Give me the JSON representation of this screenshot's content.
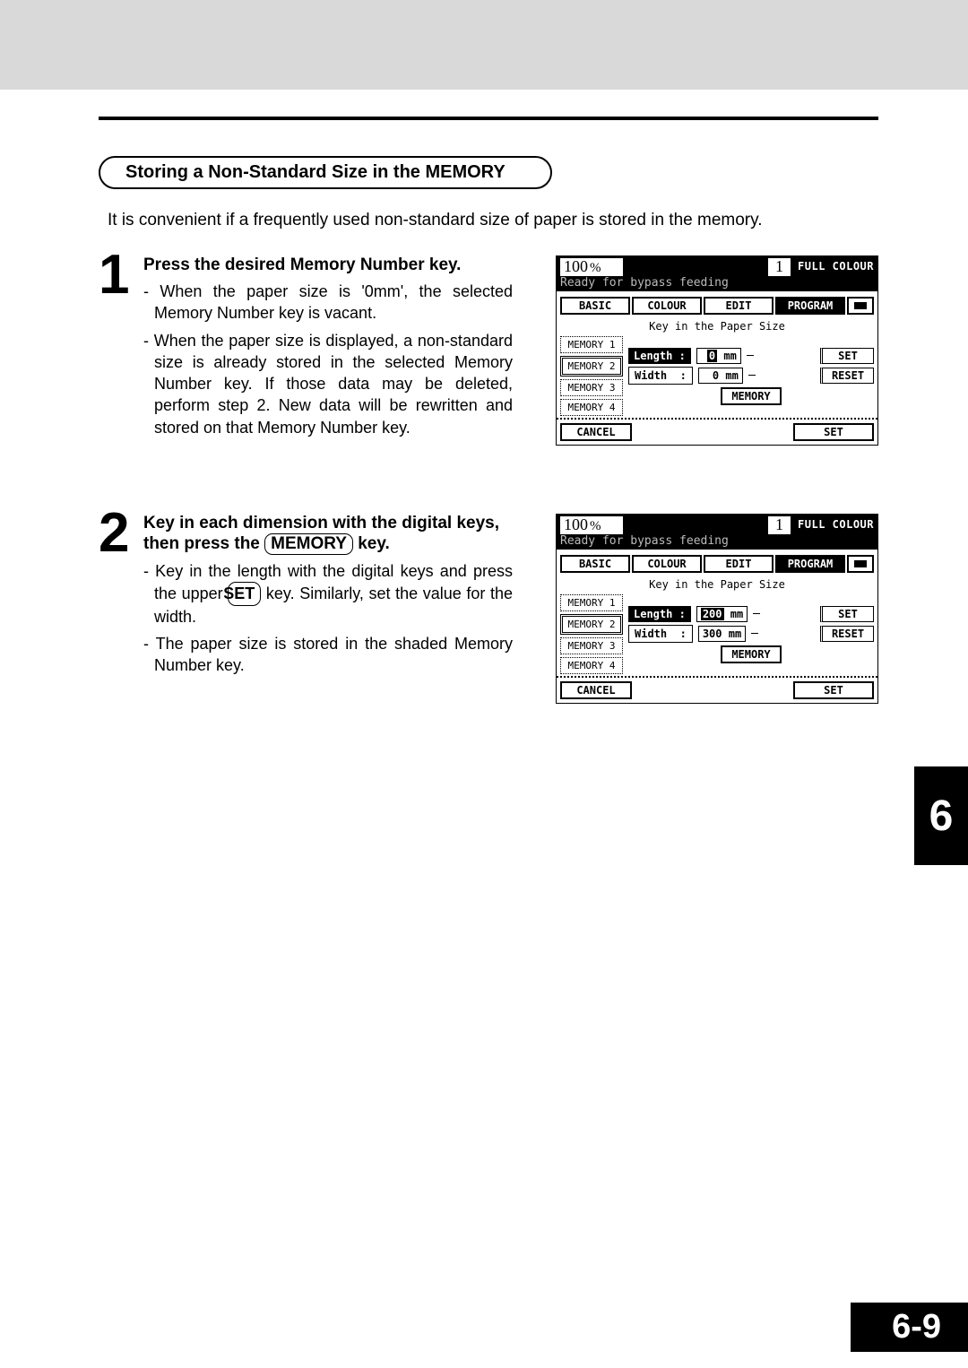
{
  "section": {
    "title": "Storing a Non-Standard Size in the MEMORY",
    "intro": "It is convenient if a frequently used non-standard size of paper is stored in the memory."
  },
  "steps": [
    {
      "num": "1",
      "heading": "Press the desired Memory Number key.",
      "bullets": [
        "When the paper size is '0mm', the selected Memory Number key is vacant.",
        "When the paper size is displayed, a non-standard size is already stored in the selected Memory Number key.  If those data may be deleted, perform step 2.  New data will be rewritten and stored on that Memory Number key."
      ]
    },
    {
      "num": "2",
      "heading_pre": "Key in  each dimension  with the digital keys,  then press the ",
      "heading_key": "MEMORY",
      "heading_post": " key.",
      "bullets_parts": [
        {
          "pre": "Key in the length with the digital keys and press the upper ",
          "key": "SET",
          "post": " key.  Similarly, set the value for the width."
        }
      ],
      "bullets_plain": [
        "The paper size is stored in the shaded Memory Number key."
      ]
    }
  ],
  "panel": {
    "zoom": "100",
    "pct": "%",
    "copies": "1",
    "mode": "FULL COLOUR",
    "status": "Ready for bypass feeding",
    "tabs": [
      "BASIC",
      "COLOUR",
      "EDIT",
      "PROGRAM"
    ],
    "prompt": "Key in the Paper Size",
    "memory_buttons": [
      "MEMORY 1",
      "MEMORY 2",
      "MEMORY 3",
      "MEMORY 4"
    ],
    "length_label": "Length",
    "width_label": "Width",
    "mm": "mm",
    "set": "SET",
    "reset": "RESET",
    "memory_key": "MEMORY",
    "cancel": "CANCEL"
  },
  "panel1": {
    "length_val": "0",
    "width_val": "0",
    "highlight_length": true,
    "highlight_width": false
  },
  "panel2": {
    "length_val": "200",
    "width_val": "300",
    "highlight_length": true,
    "highlight_width": false
  },
  "chapter": "6",
  "page": "6-9"
}
